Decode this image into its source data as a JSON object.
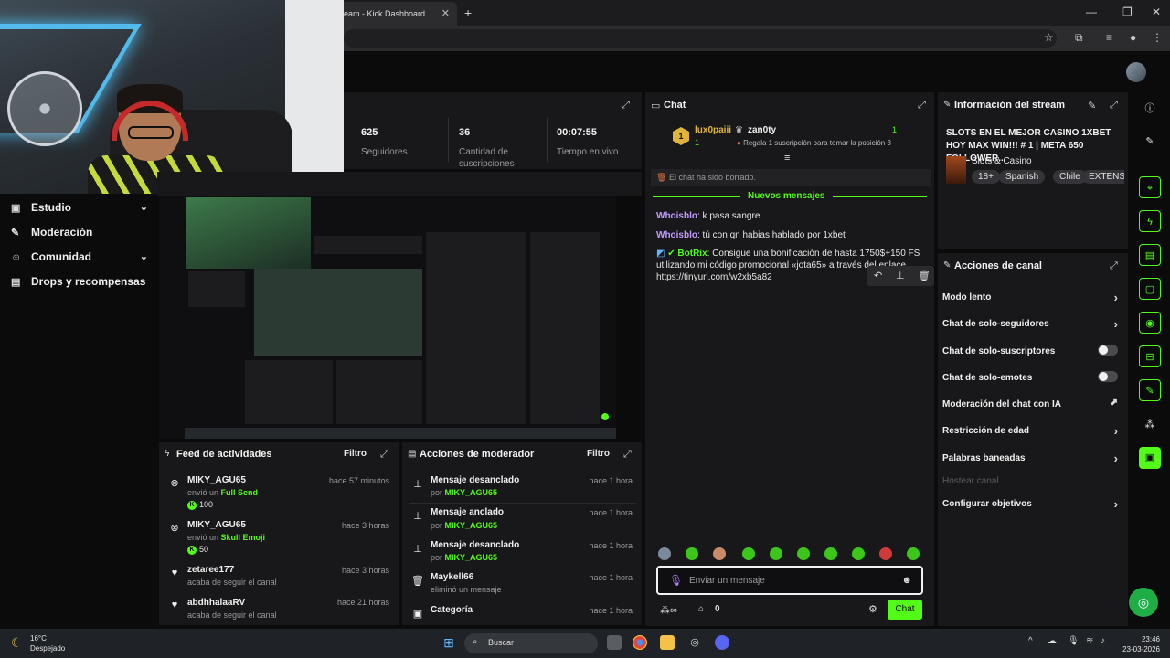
{
  "browser": {
    "tab_title": "eam - Kick Dashboard",
    "tab_close": "✕",
    "new_tab": "+",
    "window_controls": [
      "—",
      "❐",
      "✕"
    ]
  },
  "sidebar": {
    "items": [
      {
        "label": "Estudio",
        "icon": "studio-icon",
        "glyph": "▣",
        "has_chevron": true
      },
      {
        "label": "Moderación",
        "icon": "wrench-icon",
        "glyph": "✎",
        "has_chevron": false
      },
      {
        "label": "Comunidad",
        "icon": "community-icon",
        "glyph": "☺",
        "has_chevron": true
      },
      {
        "label": "Drops y recompensas",
        "icon": "drops-icon",
        "glyph": "▤",
        "has_chevron": false
      }
    ],
    "chevron": "⌄"
  },
  "stats": [
    {
      "value": "625",
      "label": "Seguidores"
    },
    {
      "value": "36",
      "label": "Cantidad de suscripciones"
    },
    {
      "value": "00:07:55",
      "label": "Tiempo en vivo"
    }
  ],
  "chat": {
    "title": "Chat",
    "leaderboard": {
      "first_user": "lux0paiii",
      "first_count": "1",
      "first_rank": "1",
      "second_user": "zan0ty",
      "second_count": "1",
      "gift_text": "Regala 1 suscripción para tomar la posición 3"
    },
    "cleared_notice": "El chat ha sido borrado.",
    "new_messages_label": "Nuevos mensajes",
    "messages": [
      {
        "user": "Whoisblo",
        "text": ": k pasa sangre"
      },
      {
        "user": "Whoisblo",
        "text": ": tú con qn habias hablado por 1xbet"
      },
      {
        "user": "BotRix",
        "text": ": Consigue una bonificación de hasta 1750$+150 FS utilizando mi código promocional «jota65» a través del enlace",
        "link": "https://tinyurl.com/w2xb5a82"
      }
    ],
    "input_placeholder": "Enviar un mensaje",
    "send_label": "Chat",
    "footer_count": "0"
  },
  "stream_info": {
    "title": "Información del stream",
    "stream_title": "SLOTS EN EL MEJOR CASINO 1XBET HOY MAX WIN!!! # 1 | META 650 FOLLOWER...",
    "category": "Slots & Casino",
    "tags": [
      "18+",
      "Spanish",
      "Chile",
      "EXTENS"
    ]
  },
  "channel_actions": {
    "title": "Acciones de canal",
    "items": [
      {
        "label": "Modo lento",
        "control": "chevron"
      },
      {
        "label": "Chat de solo-seguidores",
        "control": "chevron"
      },
      {
        "label": "Chat de solo-suscriptores",
        "control": "toggle-off"
      },
      {
        "label": "Chat de solo-emotes",
        "control": "toggle-off"
      },
      {
        "label": "Moderación del chat con IA",
        "control": "external"
      },
      {
        "label": "Restricción de edad",
        "control": "chevron"
      },
      {
        "label": "Palabras baneadas",
        "control": "chevron"
      },
      {
        "label": "Hostear canal",
        "control": "disabled"
      },
      {
        "label": "Configurar objetivos",
        "control": "chevron"
      }
    ]
  },
  "activity_feed": {
    "title": "Feed de actividades",
    "filter": "Filtro",
    "rows": [
      {
        "user": "MIKY_AGU65",
        "action": "envió un",
        "item": "Full Send",
        "kicks": "100",
        "time": "hace 57 minutos",
        "icon": "kick-icon"
      },
      {
        "user": "MIKY_AGU65",
        "action": "envió un",
        "item": "Skull Emoji",
        "kicks": "50",
        "time": "hace 3 horas",
        "icon": "kick-icon"
      },
      {
        "user": "zetaree177",
        "action": "acaba de seguir el canal",
        "item": "",
        "kicks": "",
        "time": "hace 3 horas",
        "icon": "heart-icon"
      },
      {
        "user": "abdhhalaaRV",
        "action": "acaba de seguir el canal",
        "item": "",
        "kicks": "",
        "time": "hace 21 horas",
        "icon": "heart-icon"
      }
    ]
  },
  "mod_actions": {
    "title": "Acciones de moderador",
    "filter": "Filtro",
    "rows": [
      {
        "action": "Mensaje desanclado",
        "by": "por",
        "user": "MIKY_AGU65",
        "time": "hace 1 hora",
        "icon": "unpin-icon"
      },
      {
        "action": "Mensaje anclado",
        "by": "por",
        "user": "MIKY_AGU65",
        "time": "hace 1 hora",
        "icon": "pin-icon"
      },
      {
        "action": "Mensaje desanclado",
        "by": "por",
        "user": "MIKY_AGU65",
        "time": "hace 1 hora",
        "icon": "unpin-icon"
      },
      {
        "action": "Maykell66",
        "by": "eliminó un mensaje",
        "user": "",
        "time": "hace 1 hora",
        "icon": "trash-icon"
      },
      {
        "action": "Categoría",
        "by": "",
        "user": "",
        "time": "hace 1 hora",
        "icon": "category-icon"
      }
    ]
  },
  "taskbar": {
    "temperature": "16°C",
    "weather": "Despejado",
    "search": "Buscar",
    "time": "23:46",
    "date": "23-03-2026"
  },
  "colors": {
    "accent": "#53fc18",
    "panel": "#18181a",
    "background": "#0b0b0c",
    "username_purple": "#c39bff"
  }
}
